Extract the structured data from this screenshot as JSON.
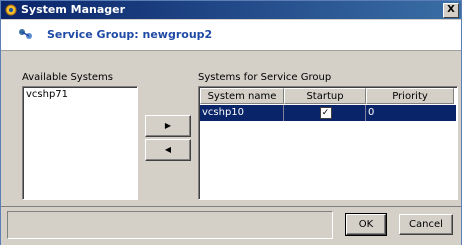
{
  "window": {
    "title": "System Manager",
    "close_glyph": "X"
  },
  "header": {
    "icon": "service-group-icon",
    "text": "Service Group: newgroup2"
  },
  "available": {
    "label": "Available Systems",
    "items": [
      "vcshp71"
    ]
  },
  "transfer": {
    "add_glyph": "▶",
    "remove_glyph": "◀"
  },
  "selected": {
    "label": "Systems for Service Group",
    "columns": [
      "System name",
      "Startup",
      "Priority"
    ],
    "rows": [
      {
        "system": "vcshp10",
        "startup_checked": true,
        "check_glyph": "✓",
        "priority": "0"
      }
    ]
  },
  "buttons": {
    "ok": "OK",
    "cancel": "Cancel"
  },
  "colors": {
    "accent": "#0a246a",
    "header_text": "#1f4aa5"
  }
}
